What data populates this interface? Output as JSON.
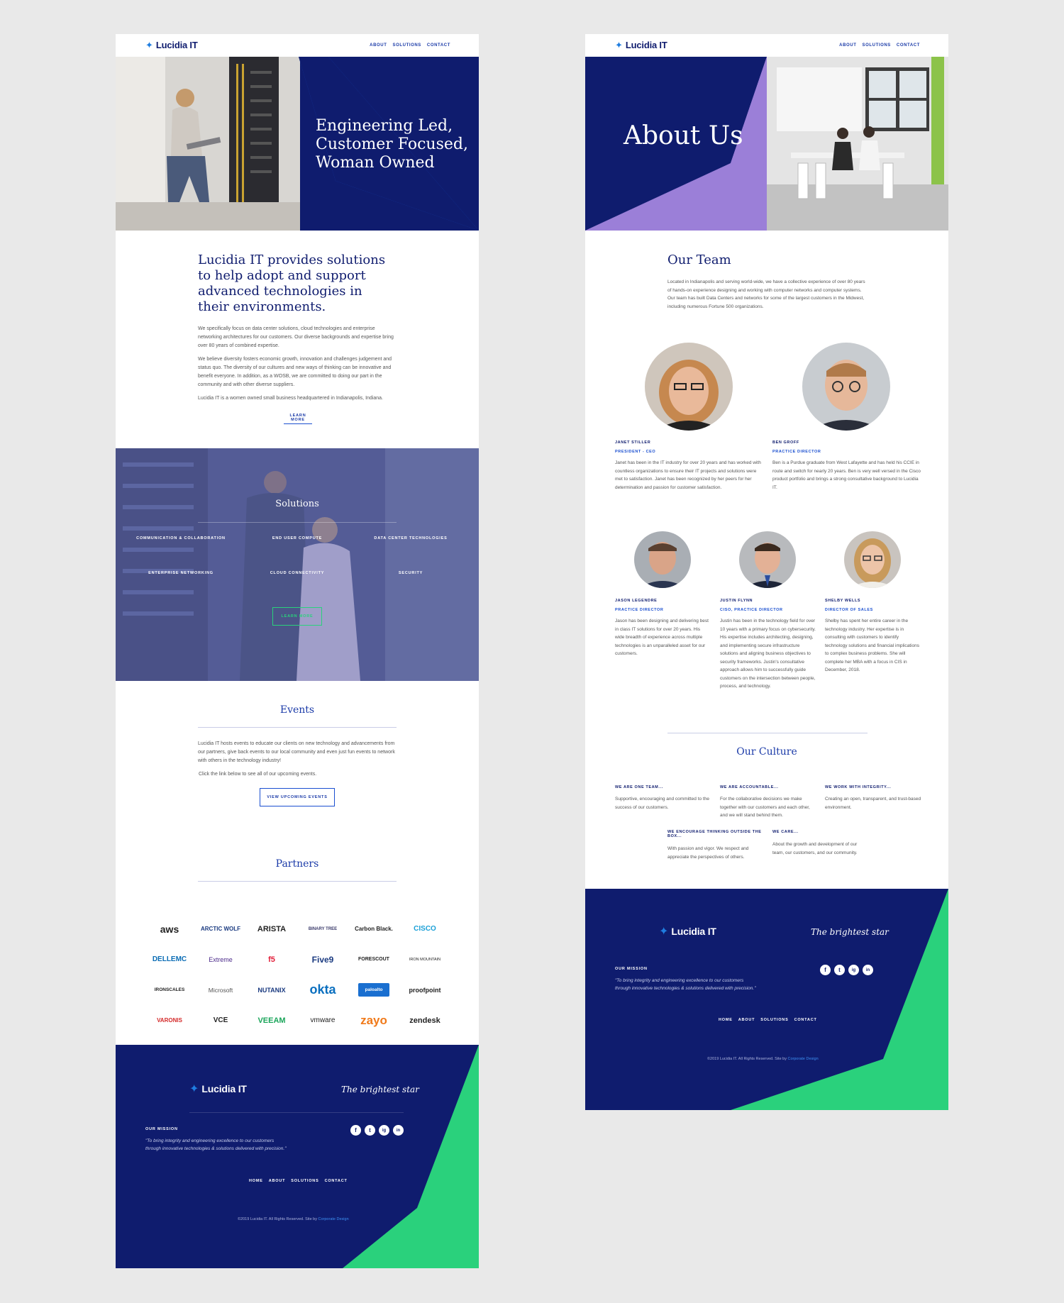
{
  "brand": {
    "name": "Lucidia IT",
    "tagline": "The brightest star"
  },
  "nav": {
    "about": "ABOUT",
    "solutions": "SOLUTIONS",
    "contact": "CONTACT"
  },
  "home": {
    "hero_title": [
      "Engineering Led,",
      "Customer Focused,",
      "Woman Owned"
    ],
    "intro": {
      "heading": "Lucidia IT provides solutions to help adopt and support advanced technologies in their environments.",
      "p1": "We specifically focus on data center solutions, cloud technologies and enterprise networking architectures for our customers. Our diverse backgrounds and expertise bring over 80 years of combined expertise.",
      "p2": "We believe diversity fosters economic growth, innovation and challenges judgement and status quo. The diversity of our cultures and new ways of thinking can be innovative and benefit everyone. In addition, as a WOSB, we are committed to doing our part in the community and with other diverse suppliers.",
      "p3": "Lucidia IT is a women owned small business headquartered in Indianapolis, Indiana.",
      "cta": "LEARN MORE"
    },
    "solutions": {
      "title": "Solutions",
      "items": [
        "COMMUNICATION & COLLABORATION",
        "END USER COMPUTE",
        "DATA CENTER TECHNOLOGIES",
        "ENTERPRISE NETWORKING",
        "CLOUD CONNECTIVITY",
        "SECURITY"
      ],
      "cta": "LEARN MORE"
    },
    "events": {
      "title": "Events",
      "p1": "Lucidia IT hosts events to educate our clients on new technology and advancements from our partners, give back events to our local community and even just fun events to network with others in the technology industry!",
      "p2": "Click the link below to see all of our upcoming events.",
      "cta": "VIEW UPCOMING EVENTS"
    },
    "partners": {
      "title": "Partners",
      "logos": [
        "aws",
        "ARCTIC WOLF",
        "ARISTA",
        "BINARY TREE",
        "Carbon Black.",
        "CISCO",
        "DELLEMC",
        "Extreme",
        "f5",
        "Five9",
        "FORESCOUT",
        "IRON MOUNTAIN",
        "IRONSCALES",
        "Microsoft",
        "NUTANIX",
        "okta",
        "paloalto",
        "proofpoint",
        "VARONIS",
        "VCE",
        "VEEAM",
        "vmware",
        "zayo",
        "zendesk"
      ]
    }
  },
  "footer": {
    "mission_label": "OUR MISSION",
    "mission": "\"To bring integrity and engineering excellence to our customers through innovative technologies & solutions delivered with precision.\"",
    "links": [
      "HOME",
      "ABOUT",
      "SOLUTIONS",
      "CONTACT"
    ],
    "social": [
      "f",
      "t",
      "ig",
      "in"
    ],
    "copyright": "©2019 Lucidia IT. All Rights Reserved. Site by",
    "credit": "Corporate Design"
  },
  "about": {
    "hero_title": "About Us",
    "team_title": "Our Team",
    "team_intro": "Located in Indianapolis and serving world-wide, we have a collective experience of over 80 years of hands-on experience designing and working with computer networks and computer systems. Our team has built Data Centers and networks for some of the largest customers in the Midwest, including numerous Fortune 500 organizations.",
    "members": [
      {
        "name": "JANET STILLER",
        "role": "PRESIDENT - CEO",
        "bio": "Janet has been in the IT industry for over 20 years and has worked with countless organizations to ensure their IT projects and solutions were met to satisfaction. Janet has been recognized by her peers for her determination and passion for customer satisfaction."
      },
      {
        "name": "BEN GROFF",
        "role": "PRACTICE DIRECTOR",
        "bio": "Ben is a Purdue graduate from West Lafayette and has held his CCIE in route and switch for nearly 20 years. Ben is very well versed in the Cisco product portfolio and brings a strong consultative background to Lucidia IT."
      },
      {
        "name": "JASON LEGENDRE",
        "role": "PRACTICE DIRECTOR",
        "bio": "Jason has been designing and delivering best in class IT solutions for over 20 years. His wide breadth of experience across multiple technologies is an unparalleled asset for our customers."
      },
      {
        "name": "JUSTIN FLYNN",
        "role": "CISO, PRACTICE DIRECTOR",
        "bio": "Justin has been in the technology field for over 10 years with a primary focus on cybersecurity. His expertise includes architecting, designing, and implementing secure infrastructure solutions and aligning business objectives to security frameworks. Justin's consultative approach allows him to successfully guide customers on the intersection between people, process, and technology."
      },
      {
        "name": "SHELBY WELLS",
        "role": "DIRECTOR OF SALES",
        "bio": "Shelby has spent her entire career in the technology industry. Her expertise is in consulting with customers to identify technology solutions and financial implications to complex business problems. She will complete her MBA with a focus in CIS in December, 2018."
      }
    ],
    "culture_title": "Our Culture",
    "culture": [
      {
        "title": "WE ARE ONE TEAM...",
        "text": "Supportive, encouraging and committed to the success of our customers."
      },
      {
        "title": "WE ARE ACCOUNTABLE...",
        "text": "For the collaborative decisions we make together with our customers and each other, and we will stand behind them."
      },
      {
        "title": "WE WORK WITH INTEGRITY...",
        "text": "Creating an open, transparent, and trust-based environment."
      },
      {
        "title": "WE ENCOURAGE THINKING OUTSIDE THE BOX...",
        "text": "With passion and vigor. We respect and appreciate the perspectives of others."
      },
      {
        "title": "WE CARE...",
        "text": "About the growth and development of our team, our customers, and our community."
      }
    ]
  },
  "colors": {
    "navy": "#0f1c6e",
    "blue": "#1a4fd0",
    "accent_green": "#2ad17c",
    "purple": "#9b7fd8"
  }
}
